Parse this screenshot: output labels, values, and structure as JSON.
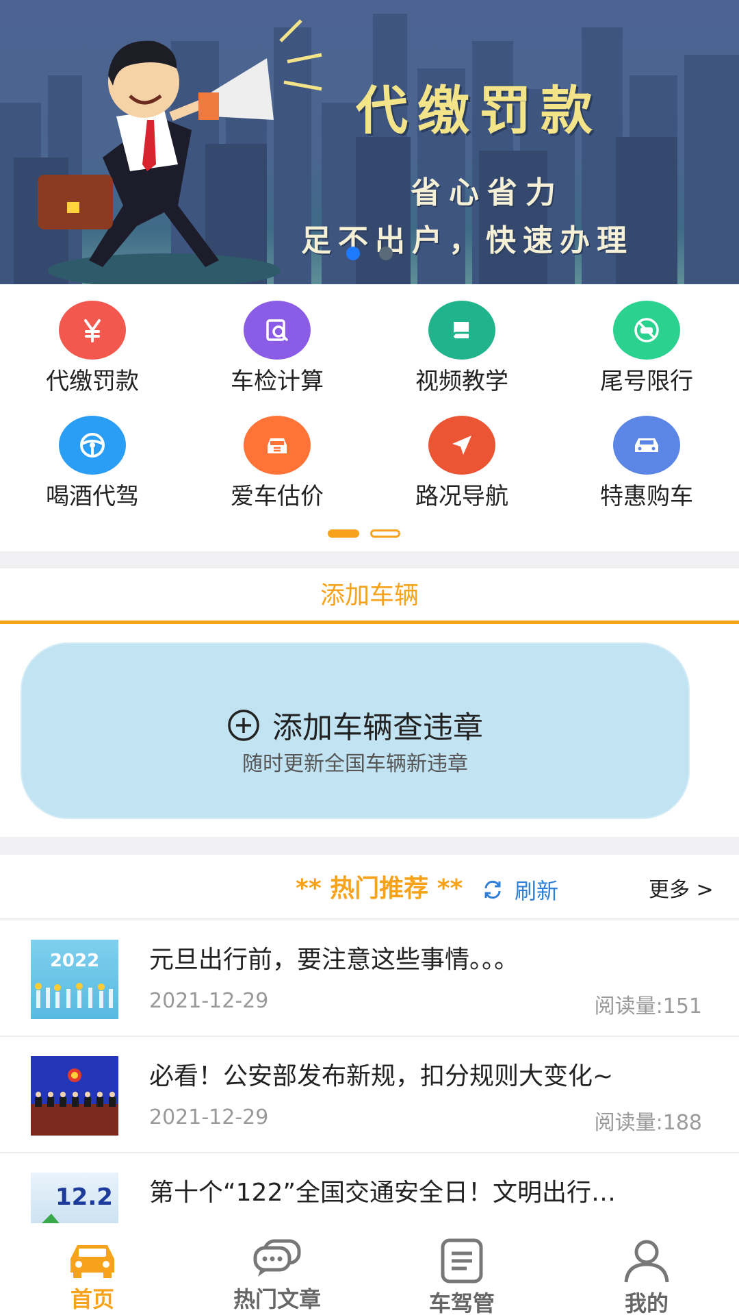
{
  "banner": {
    "title": "代缴罚款",
    "subtitle_1": "省心省力",
    "subtitle_2": "足不出户，快速办理"
  },
  "grid": {
    "items": [
      {
        "label": "代缴罚款",
        "icon": "yen-icon",
        "color": "#f2584e"
      },
      {
        "label": "车检计算",
        "icon": "inspection-icon",
        "color": "#8b5ce6"
      },
      {
        "label": "视频教学",
        "icon": "book-icon",
        "color": "#21b38b"
      },
      {
        "label": "尾号限行",
        "icon": "no-car-icon",
        "color": "#2bd18f"
      },
      {
        "label": "喝酒代驾",
        "icon": "steering-wheel-icon",
        "color": "#2a9df4"
      },
      {
        "label": "爱车估价",
        "icon": "car-value-icon",
        "color": "#ff7337"
      },
      {
        "label": "路况导航",
        "icon": "navigation-icon",
        "color": "#eb5534"
      },
      {
        "label": "特惠购车",
        "icon": "car-icon",
        "color": "#5b86e6"
      }
    ]
  },
  "add_vehicle": {
    "tab_title": "添加车辆",
    "main": "添加车辆查违章",
    "sub": "随时更新全国车辆新违章"
  },
  "hot": {
    "title": "** 热门推荐 **",
    "refresh": "刷新",
    "more": "更多 >",
    "articles": [
      {
        "title": "元旦出行前，要注意这些事情。。。",
        "date": "2021-12-29",
        "reads": "阅读量:151",
        "thumb_text": "2022"
      },
      {
        "title": "必看！公安部发布新规，扣分规则大变化~",
        "date": "2021-12-29",
        "reads": "阅读量:188",
        "thumb_text": ""
      },
      {
        "title": "第十个“122”全国交通安全日！文明出行…",
        "date": "",
        "reads": "",
        "thumb_text": "12.2"
      }
    ]
  },
  "tabbar": {
    "active_color": "#f7a21b",
    "tabs": [
      {
        "label": "首页",
        "icon": "home-car-icon"
      },
      {
        "label": "热门文章",
        "icon": "chat-bubbles-icon"
      },
      {
        "label": "车驾管",
        "icon": "document-icon"
      },
      {
        "label": "我的",
        "icon": "user-icon"
      }
    ]
  }
}
